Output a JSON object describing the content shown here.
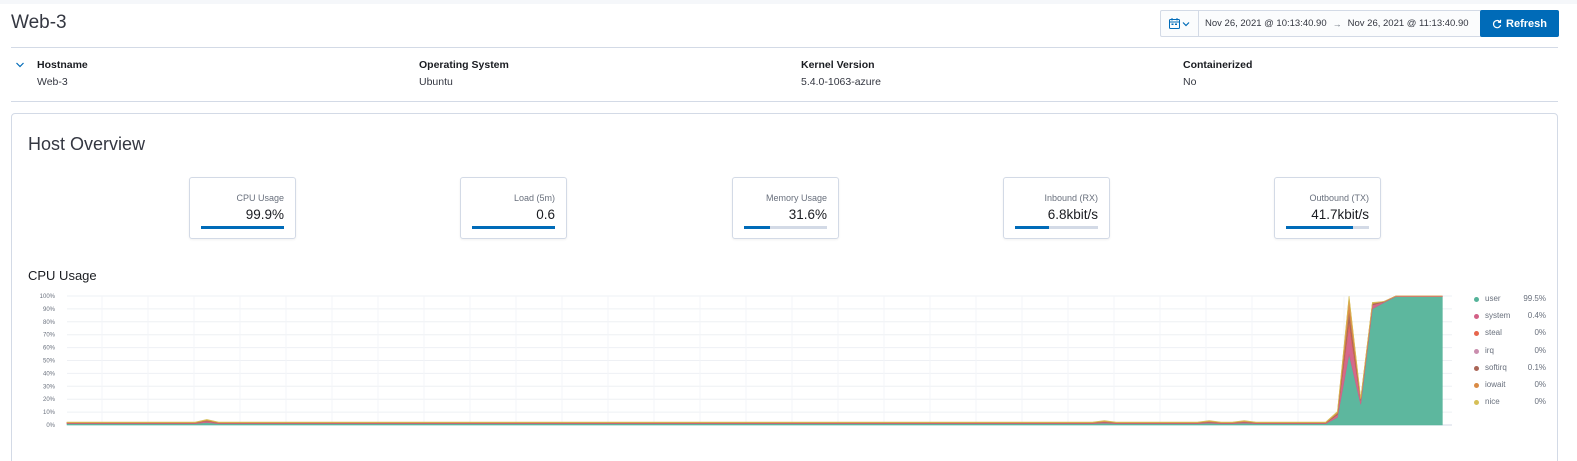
{
  "header": {
    "title": "Web-3",
    "date_start": "Nov 26, 2021 @ 10:13:40.90",
    "date_arrow": "→",
    "date_end": "Nov 26, 2021 @ 11:13:40.90",
    "refresh_label": "Refresh",
    "calendar_icon": "calendar-icon",
    "refresh_icon": "refresh-icon"
  },
  "metadata": [
    {
      "label": "Hostname",
      "value": "Web-3"
    },
    {
      "label": "Operating System",
      "value": "Ubuntu"
    },
    {
      "label": "Kernel Version",
      "value": "5.4.0-1063-azure"
    },
    {
      "label": "Containerized",
      "value": "No"
    }
  ],
  "overview": {
    "title": "Host Overview",
    "stats": [
      {
        "label": "CPU Usage",
        "value": "99.9%",
        "progress": 0.999
      },
      {
        "label": "Load (5m)",
        "value": "0.6",
        "progress": 1.0
      },
      {
        "label": "Memory Usage",
        "value": "31.6%",
        "progress": 0.316
      },
      {
        "label": "Inbound (RX)",
        "value": "6.8kbit/s",
        "progress": 0.41
      },
      {
        "label": "Outbound (TX)",
        "value": "41.7kbit/s",
        "progress": 0.81
      }
    ]
  },
  "colors": {
    "accent": "#006bb8",
    "user": "#54b399",
    "system": "#d36086",
    "steal": "#e7664c",
    "irq": "#ca8eae",
    "softirq": "#aa6556",
    "iowait": "#da8b45",
    "nice": "#d6bf57"
  },
  "chart_data": {
    "type": "area",
    "title": "CPU Usage",
    "y_ticks": [
      "100%",
      "90%",
      "80%",
      "70%",
      "60%",
      "50%",
      "40%",
      "30%",
      "20%",
      "10%",
      "0%"
    ],
    "ylim": [
      0,
      100
    ],
    "stacked": true,
    "grid": true,
    "legend_position": "right",
    "legend": [
      {
        "name": "user",
        "value": "99.5%",
        "color": "#54b399"
      },
      {
        "name": "system",
        "value": "0.4%",
        "color": "#d36086"
      },
      {
        "name": "steal",
        "value": "0%",
        "color": "#e7664c"
      },
      {
        "name": "irq",
        "value": "0%",
        "color": "#ca8eae"
      },
      {
        "name": "softirq",
        "value": "0.1%",
        "color": "#aa6556"
      },
      {
        "name": "iowait",
        "value": "0%",
        "color": "#da8b45"
      },
      {
        "name": "nice",
        "value": "0%",
        "color": "#d6bf57"
      }
    ],
    "series": [
      {
        "name": "user",
        "values": [
          1.0,
          1.0,
          1.0,
          1.0,
          1.0,
          1.0,
          1.0,
          1.0,
          1.0,
          1.0,
          1.0,
          1.0,
          2.0,
          1.0,
          1.0,
          1.0,
          1.0,
          1.0,
          1.0,
          1.0,
          1.0,
          1.0,
          1.0,
          1.0,
          1.0,
          1.0,
          1.0,
          1.0,
          1.0,
          1.0,
          1.0,
          1.0,
          1.0,
          1.0,
          1.0,
          1.0,
          1.0,
          1.0,
          1.0,
          1.0,
          1.0,
          1.0,
          1.0,
          1.0,
          1.0,
          1.0,
          1.0,
          1.0,
          1.0,
          1.0,
          1.0,
          1.0,
          1.0,
          1.0,
          1.0,
          1.0,
          1.0,
          1.0,
          1.0,
          1.0,
          1.0,
          1.0,
          1.0,
          1.0,
          1.0,
          1.0,
          1.0,
          1.0,
          1.0,
          1.0,
          1.0,
          1.0,
          1.0,
          1.0,
          1.0,
          1.0,
          1.0,
          1.0,
          1.0,
          1.0,
          1.0,
          1.0,
          1.0,
          1.0,
          1.0,
          1.0,
          1.0,
          1.0,
          1.0,
          1.5,
          1.0,
          1.0,
          1.0,
          1.0,
          1.0,
          1.0,
          1.0,
          1.0,
          1.5,
          1.0,
          1.0,
          1.5,
          1.0,
          1.0,
          1.0,
          1.0,
          1.0,
          1.0,
          1.0,
          6.0,
          55.0,
          16.0,
          90.0,
          95.0,
          99.5,
          99.5,
          99.5,
          99.5,
          99.5
        ]
      },
      {
        "name": "system",
        "values": [
          0.5,
          0.5,
          0.5,
          0.5,
          0.5,
          0.5,
          0.5,
          0.5,
          0.5,
          0.5,
          0.5,
          0.5,
          1.0,
          0.5,
          0.5,
          0.5,
          0.5,
          0.5,
          0.5,
          0.5,
          0.5,
          0.5,
          0.5,
          0.5,
          0.5,
          0.5,
          0.5,
          0.5,
          0.5,
          0.5,
          0.5,
          0.5,
          0.5,
          0.5,
          0.5,
          0.5,
          0.5,
          0.5,
          0.5,
          0.5,
          0.5,
          0.5,
          0.5,
          0.5,
          0.5,
          0.5,
          0.5,
          0.5,
          0.5,
          0.5,
          0.5,
          0.5,
          0.5,
          0.5,
          0.5,
          0.5,
          0.5,
          0.5,
          0.5,
          0.5,
          0.5,
          0.5,
          0.5,
          0.5,
          0.5,
          0.5,
          0.5,
          0.5,
          0.5,
          0.5,
          0.5,
          0.5,
          0.5,
          0.5,
          0.5,
          0.5,
          0.5,
          0.5,
          0.5,
          0.5,
          0.5,
          0.5,
          0.5,
          0.5,
          0.5,
          0.5,
          0.5,
          0.5,
          0.5,
          0.8,
          0.5,
          0.5,
          0.5,
          0.5,
          0.5,
          0.5,
          0.5,
          0.5,
          0.8,
          0.5,
          0.5,
          0.8,
          0.5,
          0.5,
          0.5,
          0.5,
          0.5,
          0.5,
          0.5,
          2.0,
          22.0,
          3.0,
          3.0,
          0.5,
          0.4,
          0.4,
          0.4,
          0.4,
          0.4
        ]
      },
      {
        "name": "steal",
        "values": [
          0,
          0,
          0,
          0,
          0,
          0,
          0,
          0,
          0,
          0,
          0,
          0,
          0,
          0,
          0,
          0,
          0,
          0,
          0,
          0,
          0,
          0,
          0,
          0,
          0,
          0,
          0,
          0,
          0,
          0,
          0,
          0,
          0,
          0,
          0,
          0,
          0,
          0,
          0,
          0,
          0,
          0,
          0,
          0,
          0,
          0,
          0,
          0,
          0,
          0,
          0,
          0,
          0,
          0,
          0,
          0,
          0,
          0,
          0,
          0,
          0,
          0,
          0,
          0,
          0,
          0,
          0,
          0,
          0,
          0,
          0,
          0,
          0,
          0,
          0,
          0,
          0,
          0,
          0,
          0,
          0,
          0,
          0,
          0,
          0,
          0,
          0,
          0,
          0,
          0,
          0,
          0,
          0,
          0,
          0,
          0,
          0,
          0,
          0,
          0,
          0,
          0,
          0,
          0,
          0,
          0,
          0,
          0,
          0,
          0,
          4.0,
          0,
          0,
          0,
          0,
          0,
          0,
          0,
          0
        ]
      },
      {
        "name": "irq",
        "values": [
          0,
          0,
          0,
          0,
          0,
          0,
          0,
          0,
          0,
          0,
          0,
          0,
          0,
          0,
          0,
          0,
          0,
          0,
          0,
          0,
          0,
          0,
          0,
          0,
          0,
          0,
          0,
          0,
          0,
          0,
          0,
          0,
          0,
          0,
          0,
          0,
          0,
          0,
          0,
          0,
          0,
          0,
          0,
          0,
          0,
          0,
          0,
          0,
          0,
          0,
          0,
          0,
          0,
          0,
          0,
          0,
          0,
          0,
          0,
          0,
          0,
          0,
          0,
          0,
          0,
          0,
          0,
          0,
          0,
          0,
          0,
          0,
          0,
          0,
          0,
          0,
          0,
          0,
          0,
          0,
          0,
          0,
          0,
          0,
          0,
          0,
          0,
          0,
          0,
          0,
          0,
          0,
          0,
          0,
          0,
          0,
          0,
          0,
          0,
          0,
          0,
          0,
          0,
          0,
          0,
          0,
          0,
          0,
          0,
          0,
          0,
          0,
          0,
          0,
          0,
          0,
          0,
          0,
          0
        ]
      },
      {
        "name": "softirq",
        "values": [
          0.3,
          0.3,
          0.3,
          0.3,
          0.3,
          0.3,
          0.3,
          0.3,
          0.3,
          0.3,
          0.3,
          0.3,
          0.5,
          0.3,
          0.3,
          0.3,
          0.3,
          0.3,
          0.3,
          0.3,
          0.3,
          0.3,
          0.3,
          0.3,
          0.3,
          0.3,
          0.3,
          0.3,
          0.3,
          0.3,
          0.3,
          0.3,
          0.3,
          0.3,
          0.3,
          0.3,
          0.3,
          0.3,
          0.3,
          0.3,
          0.3,
          0.3,
          0.3,
          0.3,
          0.3,
          0.3,
          0.3,
          0.3,
          0.3,
          0.3,
          0.3,
          0.3,
          0.3,
          0.3,
          0.3,
          0.3,
          0.3,
          0.3,
          0.3,
          0.3,
          0.3,
          0.3,
          0.3,
          0.3,
          0.3,
          0.3,
          0.3,
          0.3,
          0.3,
          0.3,
          0.3,
          0.3,
          0.3,
          0.3,
          0.3,
          0.3,
          0.3,
          0.3,
          0.3,
          0.3,
          0.3,
          0.3,
          0.3,
          0.3,
          0.3,
          0.3,
          0.3,
          0.3,
          0.3,
          0.4,
          0.3,
          0.3,
          0.3,
          0.3,
          0.3,
          0.3,
          0.3,
          0.3,
          0.4,
          0.3,
          0.3,
          0.4,
          0.3,
          0.3,
          0.3,
          0.3,
          0.3,
          0.3,
          0.3,
          1.0,
          8.0,
          1.0,
          1.0,
          0.3,
          0.1,
          0.1,
          0.1,
          0.1,
          0.1
        ]
      },
      {
        "name": "iowait",
        "values": [
          0.3,
          0.3,
          0.3,
          0.3,
          0.3,
          0.3,
          0.3,
          0.3,
          0.3,
          0.3,
          0.3,
          0.3,
          0.5,
          0.3,
          0.3,
          0.3,
          0.3,
          0.3,
          0.3,
          0.3,
          0.3,
          0.3,
          0.3,
          0.3,
          0.3,
          0.3,
          0.3,
          0.3,
          0.3,
          0.3,
          0.3,
          0.3,
          0.3,
          0.3,
          0.3,
          0.3,
          0.3,
          0.3,
          0.3,
          0.3,
          0.3,
          0.3,
          0.3,
          0.3,
          0.3,
          0.3,
          0.3,
          0.3,
          0.3,
          0.3,
          0.3,
          0.3,
          0.3,
          0.3,
          0.3,
          0.3,
          0.3,
          0.3,
          0.3,
          0.3,
          0.3,
          0.3,
          0.3,
          0.3,
          0.3,
          0.3,
          0.3,
          0.3,
          0.3,
          0.3,
          0.3,
          0.3,
          0.3,
          0.3,
          0.3,
          0.3,
          0.3,
          0.3,
          0.3,
          0.3,
          0.3,
          0.3,
          0.3,
          0.3,
          0.3,
          0.3,
          0.3,
          0.3,
          0.3,
          0.4,
          0.3,
          0.3,
          0.3,
          0.3,
          0.3,
          0.3,
          0.3,
          0.3,
          0.4,
          0.3,
          0.3,
          0.4,
          0.3,
          0.3,
          0.3,
          0.3,
          0.3,
          0.3,
          0.3,
          1.0,
          10.0,
          0.5,
          0.5,
          0,
          0,
          0,
          0,
          0,
          0
        ]
      },
      {
        "name": "nice",
        "values": [
          0.2,
          0.2,
          0.2,
          0.2,
          0.2,
          0.2,
          0.2,
          0.2,
          0.2,
          0.2,
          0.2,
          0.2,
          0.3,
          0.2,
          0.2,
          0.2,
          0.2,
          0.2,
          0.2,
          0.2,
          0.2,
          0.2,
          0.2,
          0.2,
          0.2,
          0.2,
          0.2,
          0.2,
          0.2,
          0.2,
          0.2,
          0.2,
          0.2,
          0.2,
          0.2,
          0.2,
          0.2,
          0.2,
          0.2,
          0.2,
          0.2,
          0.2,
          0.2,
          0.2,
          0.2,
          0.2,
          0.2,
          0.2,
          0.2,
          0.2,
          0.2,
          0.2,
          0.2,
          0.2,
          0.2,
          0.2,
          0.2,
          0.2,
          0.2,
          0.2,
          0.2,
          0.2,
          0.2,
          0.2,
          0.2,
          0.2,
          0.2,
          0.2,
          0.2,
          0.2,
          0.2,
          0.2,
          0.2,
          0.2,
          0.2,
          0.2,
          0.2,
          0.2,
          0.2,
          0.2,
          0.2,
          0.2,
          0.2,
          0.2,
          0.2,
          0.2,
          0.2,
          0.2,
          0.2,
          0.3,
          0.2,
          0.2,
          0.2,
          0.2,
          0.2,
          0.2,
          0.2,
          0.2,
          0.3,
          0.2,
          0.2,
          0.3,
          0.2,
          0.2,
          0.2,
          0.2,
          0.2,
          0.2,
          0.2,
          0.5,
          3.0,
          0.5,
          0.5,
          0,
          0,
          0,
          0,
          0,
          0
        ]
      }
    ]
  }
}
